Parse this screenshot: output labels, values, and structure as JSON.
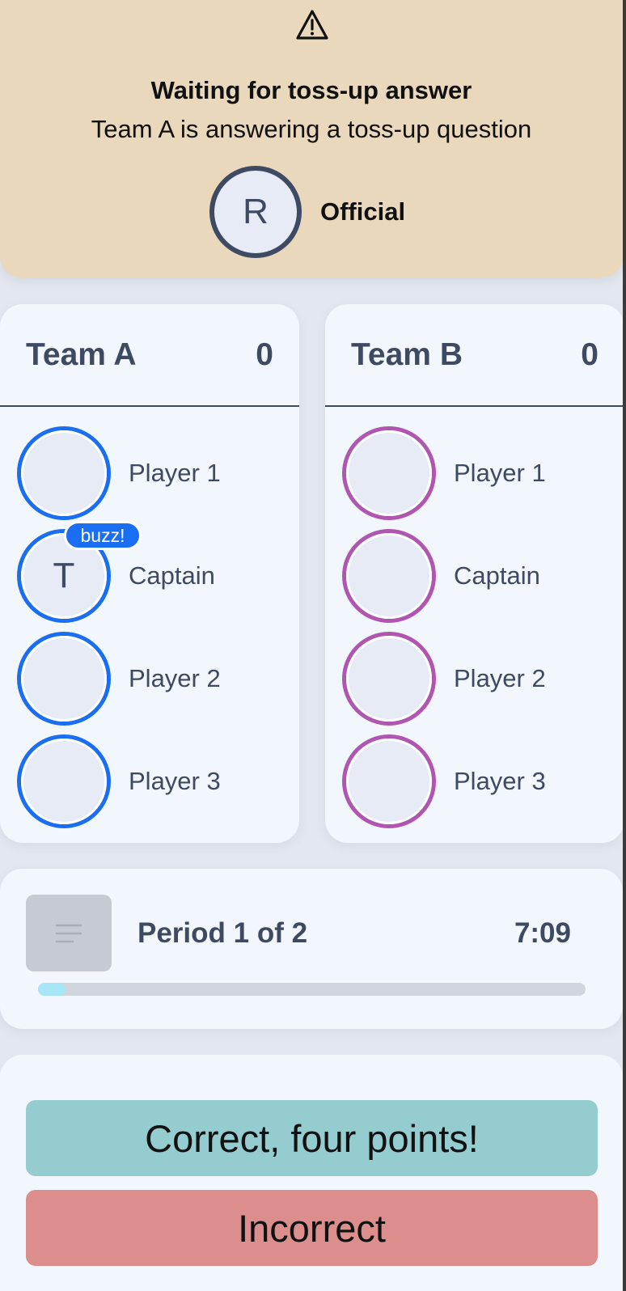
{
  "status": {
    "icon": "warning-icon",
    "title": "Waiting for toss-up answer",
    "subtitle": "Team A is answering a toss-up question",
    "official": {
      "initial": "R",
      "label": "Official"
    }
  },
  "teams": [
    {
      "name": "Team A",
      "score": "0",
      "color": "#1a6ef2",
      "players": [
        {
          "name": "Player 1",
          "initial": ""
        },
        {
          "name": "Captain",
          "initial": "T",
          "badge": "buzz!"
        },
        {
          "name": "Player 2",
          "initial": ""
        },
        {
          "name": "Player 3",
          "initial": ""
        }
      ]
    },
    {
      "name": "Team B",
      "score": "0",
      "color": "#b055b0",
      "players": [
        {
          "name": "Player 1",
          "initial": ""
        },
        {
          "name": "Captain",
          "initial": ""
        },
        {
          "name": "Player 2",
          "initial": ""
        },
        {
          "name": "Player 3",
          "initial": ""
        }
      ]
    }
  ],
  "period": {
    "menu_icon": "menu-lines-icon",
    "label": "Period 1 of 2",
    "clock": "7:09",
    "progress": 0.05
  },
  "actions": {
    "correct_label": "Correct, four points!",
    "incorrect_label": "Incorrect"
  },
  "colors": {
    "banner_bg": "#ead8bd",
    "card_bg": "#f2f6fd",
    "page_bg": "#e3e7f0",
    "correct_bg": "#94cccf",
    "incorrect_bg": "#db8e8c",
    "progress_fill": "#a6e6f6"
  }
}
